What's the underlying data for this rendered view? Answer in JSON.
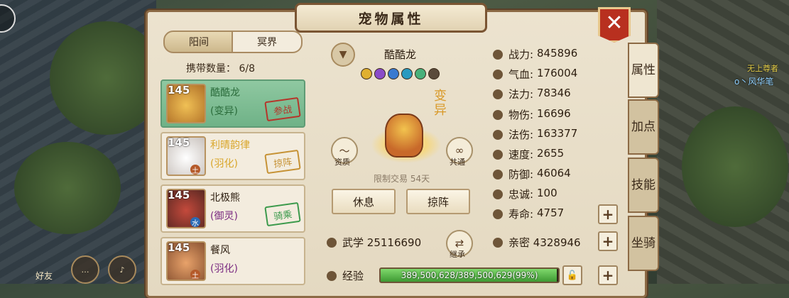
{
  "window": {
    "title": "宠物属性",
    "close_glyph": "✕"
  },
  "tabs": [
    {
      "label": "阳间",
      "active": true
    },
    {
      "label": "冥界",
      "active": false
    }
  ],
  "carry": {
    "label": "携带数量：",
    "value": "6/8"
  },
  "pets": [
    {
      "level": "145",
      "name": "酷酷龙",
      "type": "(变异)",
      "status": "参战",
      "selected": true,
      "element": ""
    },
    {
      "level": "145",
      "name": "利晴韵律",
      "type": "(羽化)",
      "status": "掠阵",
      "selected": false,
      "element": "土"
    },
    {
      "level": "145",
      "name": "北极熊",
      "type": "(御灵)",
      "status": "骑乘",
      "selected": false,
      "element": "水"
    },
    {
      "level": "145",
      "name": "餐风",
      "type": "(羽化)",
      "status": "",
      "selected": false,
      "element": "土"
    }
  ],
  "pet_detail": {
    "name": "酷酷龙",
    "variant_mark": "变异",
    "qualification_label": "资质",
    "share_label": "共通",
    "trade_limit": "限制交易 54天",
    "rest_button": "休息",
    "raid_button": "掠阵",
    "martial_label": "武学",
    "martial_value": "25116690",
    "inherit_label": "继承",
    "intimacy_label": "亲密",
    "intimacy_value": "4328946",
    "exp_label": "经验",
    "exp_text": "389,500,628/389,500,629(99%)",
    "exp_percent": 99
  },
  "skill_colors": [
    "#e0b030",
    "#8a4cc8",
    "#3a7ad0",
    "#2a9ac0",
    "#48b07a",
    "#5a4a3a"
  ],
  "stats": [
    {
      "label": "战力:",
      "value": "845896",
      "icon": "fist-icon"
    },
    {
      "label": "气血:",
      "value": "176004",
      "icon": "heart-icon"
    },
    {
      "label": "法力:",
      "value": "78346",
      "icon": "drop-icon"
    },
    {
      "label": "物伤:",
      "value": "16696",
      "icon": "sword-icon"
    },
    {
      "label": "法伤:",
      "value": "163377",
      "icon": "fire-icon"
    },
    {
      "label": "速度:",
      "value": "2655",
      "icon": "wing-icon"
    },
    {
      "label": "防御:",
      "value": "46064",
      "icon": "shield-icon"
    },
    {
      "label": "忠诚:",
      "value": "100",
      "icon": "loyalty-icon"
    },
    {
      "label": "寿命:",
      "value": "4757",
      "icon": "hourglass-icon"
    }
  ],
  "side_tabs": [
    "属性",
    "加点",
    "技能",
    "坐骑"
  ],
  "hud": {
    "friend_label": "好友",
    "name_tag_1": "无上尊者",
    "name_tag_2": "o丶风华笔"
  }
}
